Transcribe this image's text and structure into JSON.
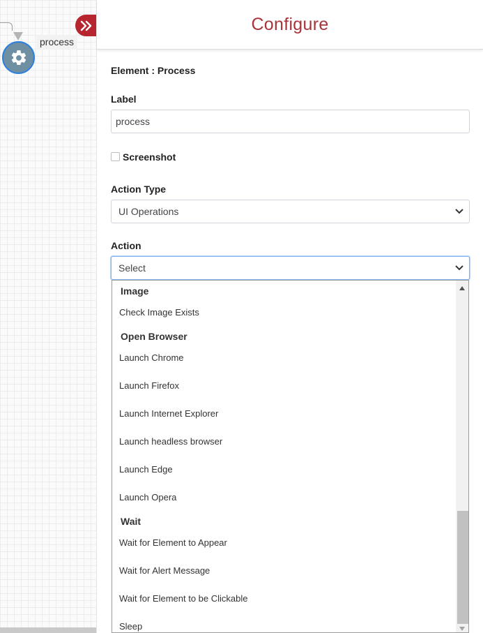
{
  "canvas": {
    "node_label": "process",
    "node_icon": "gear-icon",
    "collapse_icon": "double-chevron-right-icon",
    "accent_color": "#b7262e"
  },
  "panel": {
    "title": "Configure",
    "element_line": "Element : Process",
    "label_field": {
      "label": "Label",
      "value": "process"
    },
    "screenshot": {
      "label": "Screenshot",
      "checked": false
    },
    "action_type": {
      "label": "Action Type",
      "value": "UI Operations"
    },
    "action": {
      "label": "Action",
      "value": "Select"
    }
  },
  "dropdown": {
    "groups": [
      {
        "name": "Image",
        "items": [
          "Check Image Exists"
        ]
      },
      {
        "name": "Open Browser",
        "items": [
          "Launch Chrome",
          "Launch Firefox",
          "Launch Internet Explorer",
          "Launch headless browser",
          "Launch Edge",
          "Launch Opera"
        ]
      },
      {
        "name": "Wait",
        "items": [
          "Wait for Element to Appear",
          "Wait for Alert Message",
          "Wait for Element to be Clickable",
          "Sleep"
        ]
      }
    ]
  }
}
